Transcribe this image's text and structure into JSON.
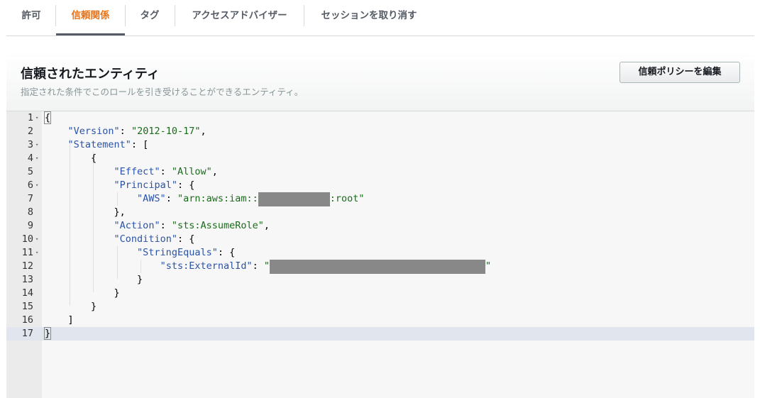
{
  "tabs": [
    {
      "label": "許可",
      "active": false
    },
    {
      "label": "信頼関係",
      "active": true
    },
    {
      "label": "タグ",
      "active": false
    },
    {
      "label": "アクセスアドバイザー",
      "active": false
    },
    {
      "label": "セッションを取り消す",
      "active": false
    }
  ],
  "panel": {
    "title": "信頼されたエンティティ",
    "description": "指定された条件でこのロールを引き受けることができるエンティティ。",
    "edit_button": "信頼ポリシーを編集"
  },
  "editor": {
    "active_line": 17,
    "lines": [
      {
        "n": "1",
        "fold": true
      },
      {
        "n": "2",
        "fold": false
      },
      {
        "n": "3",
        "fold": true
      },
      {
        "n": "4",
        "fold": true
      },
      {
        "n": "5",
        "fold": false
      },
      {
        "n": "6",
        "fold": true
      },
      {
        "n": "7",
        "fold": false
      },
      {
        "n": "8",
        "fold": false
      },
      {
        "n": "9",
        "fold": false
      },
      {
        "n": "10",
        "fold": true
      },
      {
        "n": "11",
        "fold": true
      },
      {
        "n": "12",
        "fold": false
      },
      {
        "n": "13",
        "fold": false
      },
      {
        "n": "14",
        "fold": false
      },
      {
        "n": "15",
        "fold": false
      },
      {
        "n": "16",
        "fold": false
      },
      {
        "n": "17",
        "fold": false
      }
    ],
    "code": {
      "l1": "{",
      "l2_key": "\"Version\"",
      "l2_val": "\"2012-10-17\"",
      "l3_key": "\"Statement\"",
      "l3_rest": ": [",
      "l4": "{",
      "l5_key": "\"Effect\"",
      "l5_val": "\"Allow\"",
      "l6_key": "\"Principal\"",
      "l6_rest": ": {",
      "l7_key": "\"AWS\"",
      "l7_val_start": "\"arn:aws:iam::",
      "l7_val_end": ":root\"",
      "l8": "},",
      "l9_key": "\"Action\"",
      "l9_val": "\"sts:AssumeRole\"",
      "l10_key": "\"Condition\"",
      "l10_rest": ": {",
      "l11_key": "\"StringEquals\"",
      "l11_rest": ": {",
      "l12_key": "\"sts:ExternalId\"",
      "l12_val_start": "\"",
      "l12_val_end": "\"",
      "l13": "}",
      "l14": "}",
      "l15": "}",
      "l16": "]",
      "l17": "}"
    }
  }
}
